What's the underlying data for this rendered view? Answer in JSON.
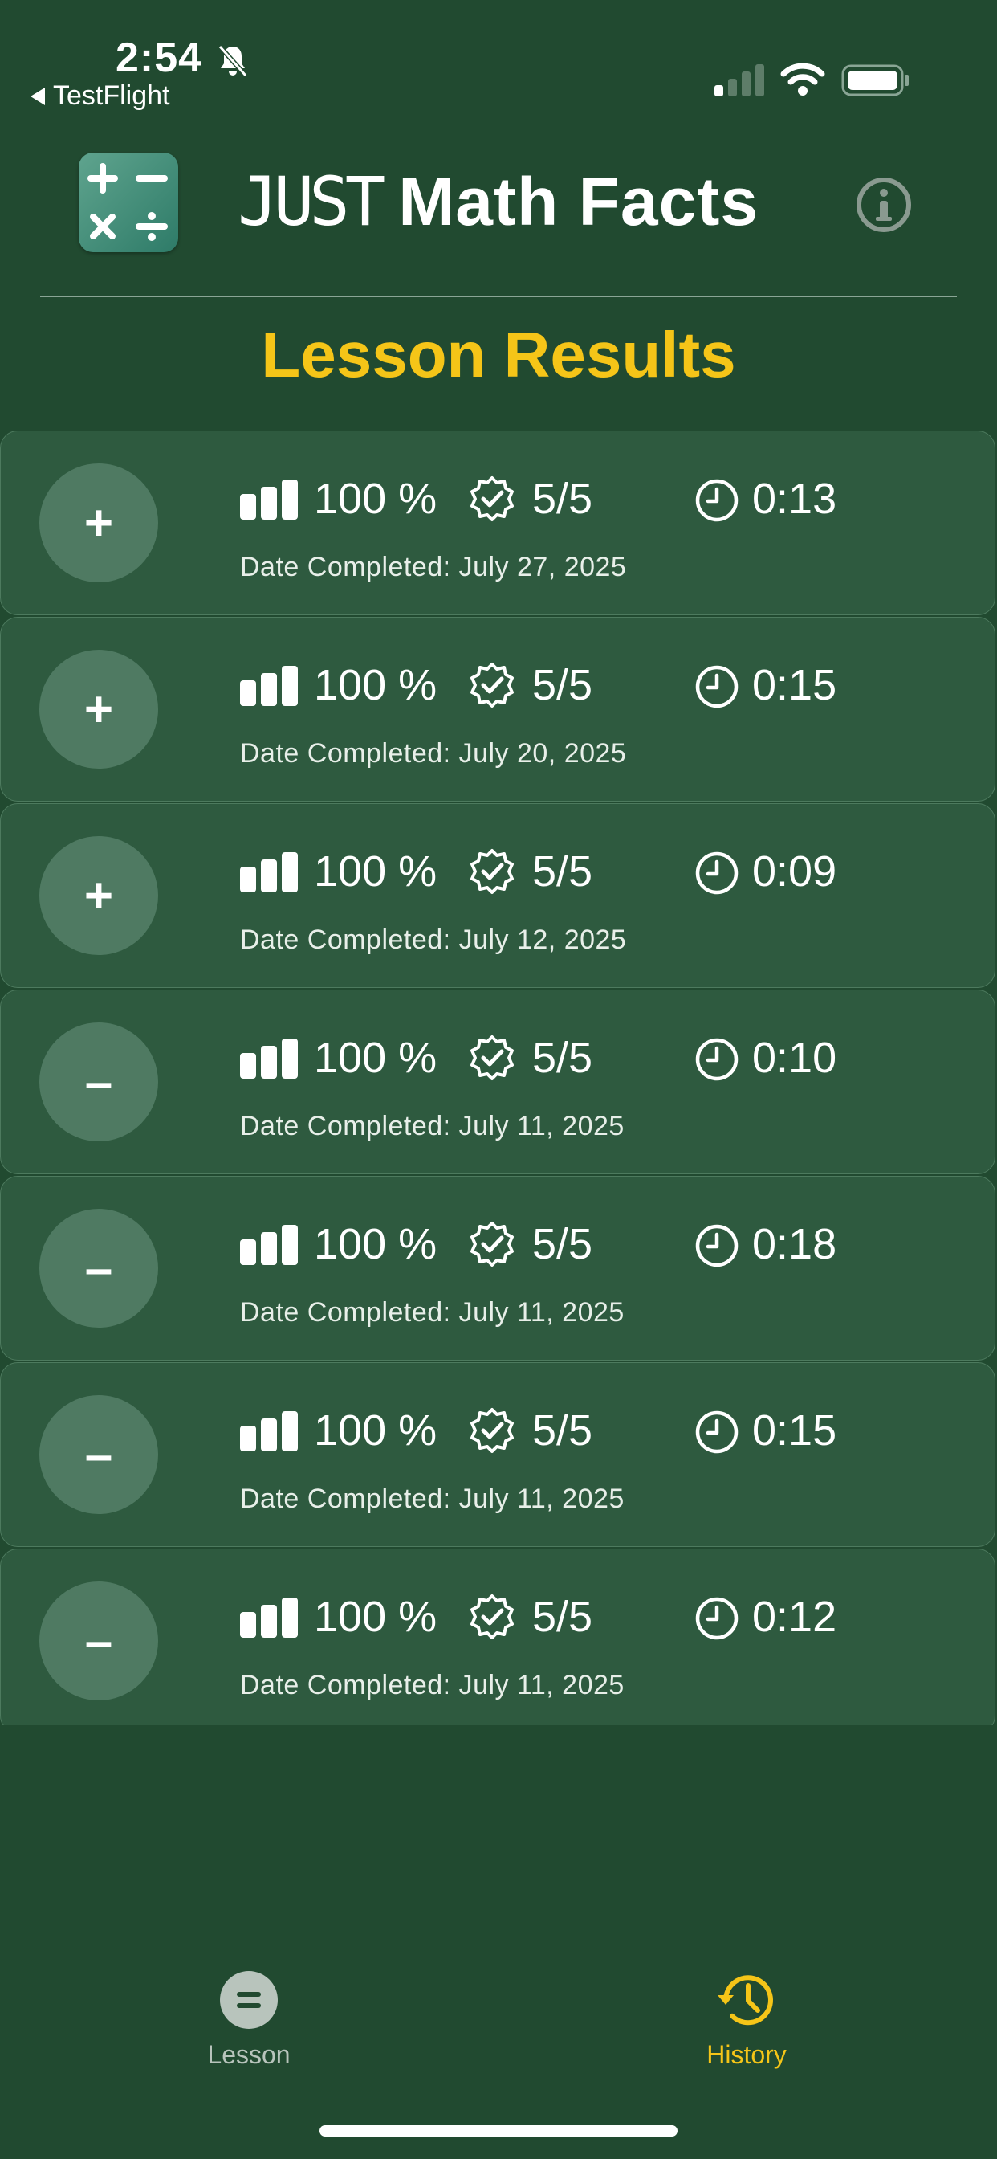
{
  "status_bar": {
    "time": "2:54",
    "back_label": "TestFlight"
  },
  "header": {
    "title_prefix": "JUST",
    "title_main": "Math Facts"
  },
  "page_title": "Lesson Results",
  "date_prefix": "Date Completed:",
  "results": [
    {
      "op": "+",
      "percent": "100 %",
      "score": "5/5",
      "time": "0:13",
      "date": "Date Completed: July 27, 2025"
    },
    {
      "op": "+",
      "percent": "100 %",
      "score": "5/5",
      "time": "0:15",
      "date": "Date Completed: July 20, 2025"
    },
    {
      "op": "+",
      "percent": "100 %",
      "score": "5/5",
      "time": "0:09",
      "date": "Date Completed: July 12, 2025"
    },
    {
      "op": "–",
      "percent": "100 %",
      "score": "5/5",
      "time": "0:10",
      "date": "Date Completed: July 11, 2025"
    },
    {
      "op": "–",
      "percent": "100 %",
      "score": "5/5",
      "time": "0:18",
      "date": "Date Completed: July 11, 2025"
    },
    {
      "op": "–",
      "percent": "100 %",
      "score": "5/5",
      "time": "0:15",
      "date": "Date Completed: July 11, 2025"
    },
    {
      "op": "–",
      "percent": "100 %",
      "score": "5/5",
      "time": "0:12",
      "date": "Date Completed: July 11, 2025"
    }
  ],
  "tabs": [
    {
      "label": "Lesson",
      "icon": "equals-circle-icon",
      "active": false
    },
    {
      "label": "History",
      "icon": "history-clock-icon",
      "active": true
    }
  ],
  "colors": {
    "background": "#214a30",
    "card": "#2e5a3f",
    "accent": "#f5c518"
  }
}
